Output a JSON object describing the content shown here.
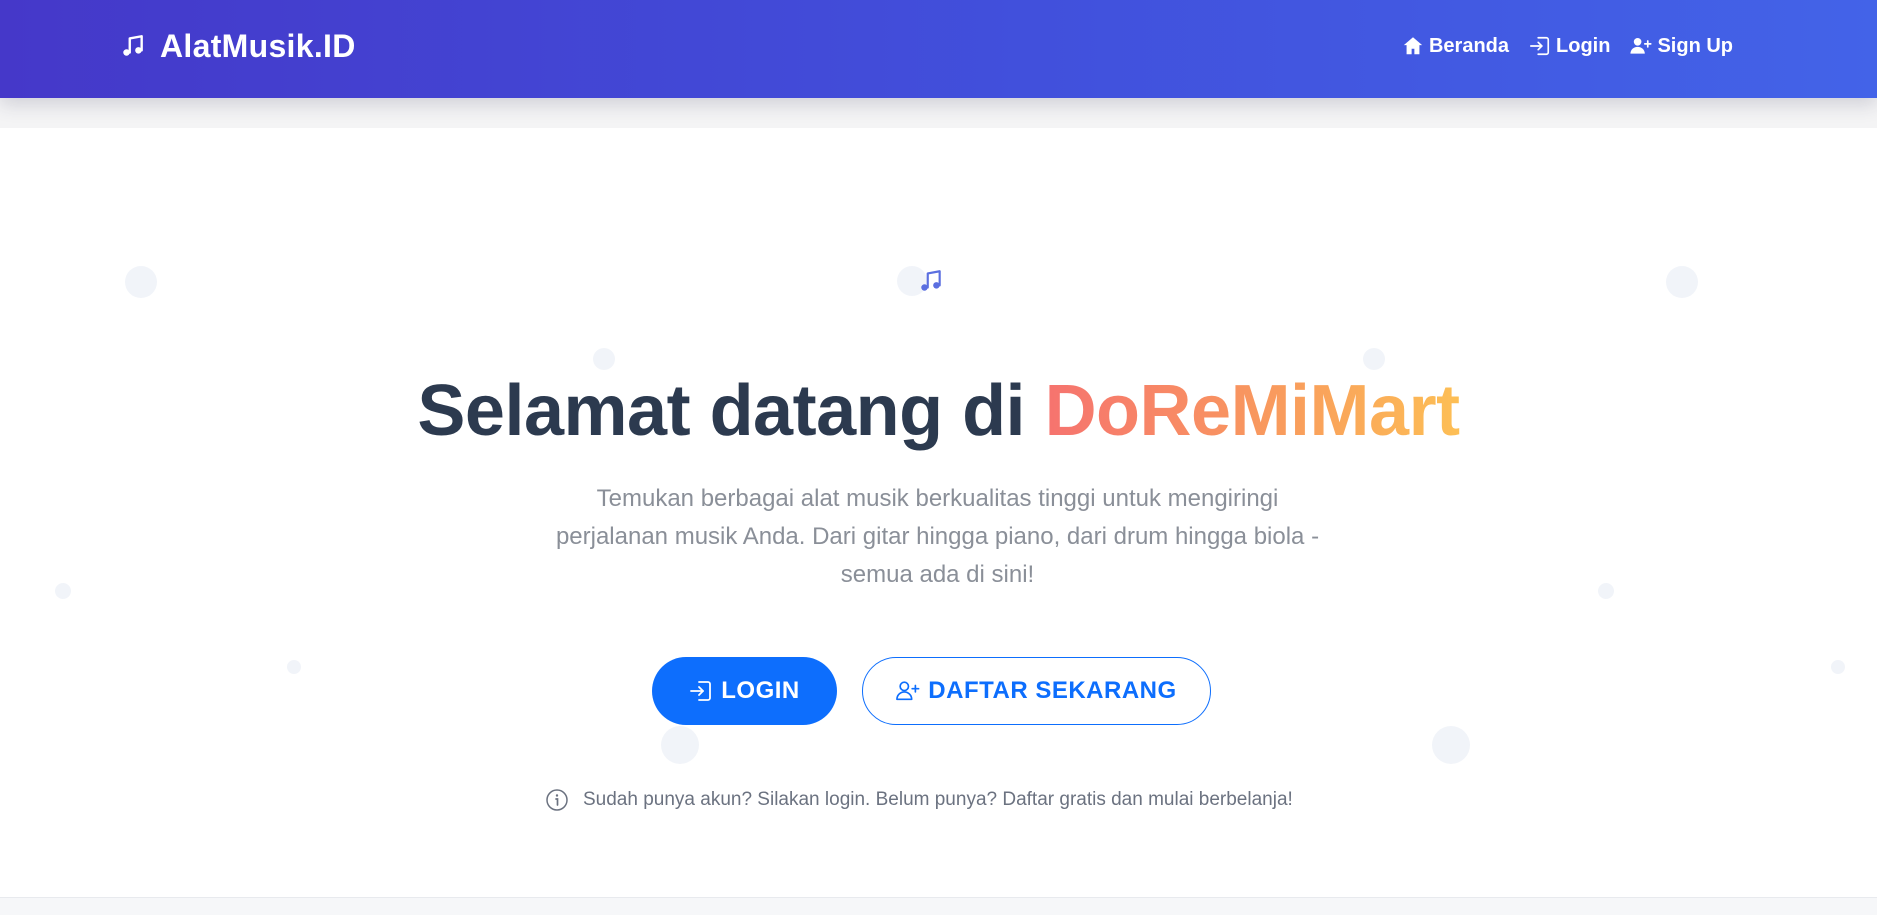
{
  "navbar": {
    "brand": "AlatMusik.ID",
    "brand_icon": "music-note-icon",
    "links": [
      {
        "label": "Beranda",
        "icon": "home-icon"
      },
      {
        "label": "Login",
        "icon": "login-icon"
      },
      {
        "label": "Sign Up",
        "icon": "user-plus-icon"
      }
    ]
  },
  "hero": {
    "icon": "music-note-icon",
    "title_prefix": "Selamat datang di ",
    "title_highlight": "DoReMiMart",
    "description": "Temukan berbagai alat musik berkualitas tinggi untuk mengiringi perjalanan musik Anda. Dari gitar hingga piano, dari drum hingga biola - semua ada di sini!",
    "buttons": {
      "login_label": "LOGIN",
      "login_icon": "login-icon",
      "register_label": "DAFTAR SEKARANG",
      "register_icon": "user-plus-icon"
    },
    "hint": "Sudah punya akun? Silakan login. Belum punya? Daftar gratis dan mulai berbelanja!",
    "hint_icon": "info-icon"
  },
  "colors": {
    "navbar_gradient_start": "#4538c9",
    "navbar_gradient_end": "#4363e8",
    "title_text": "#2c3a4f",
    "highlight_gradient_start": "#f6736f",
    "highlight_gradient_end": "#fdbf55",
    "primary_blue": "#0d6efd",
    "muted_text": "#8a8f98"
  }
}
